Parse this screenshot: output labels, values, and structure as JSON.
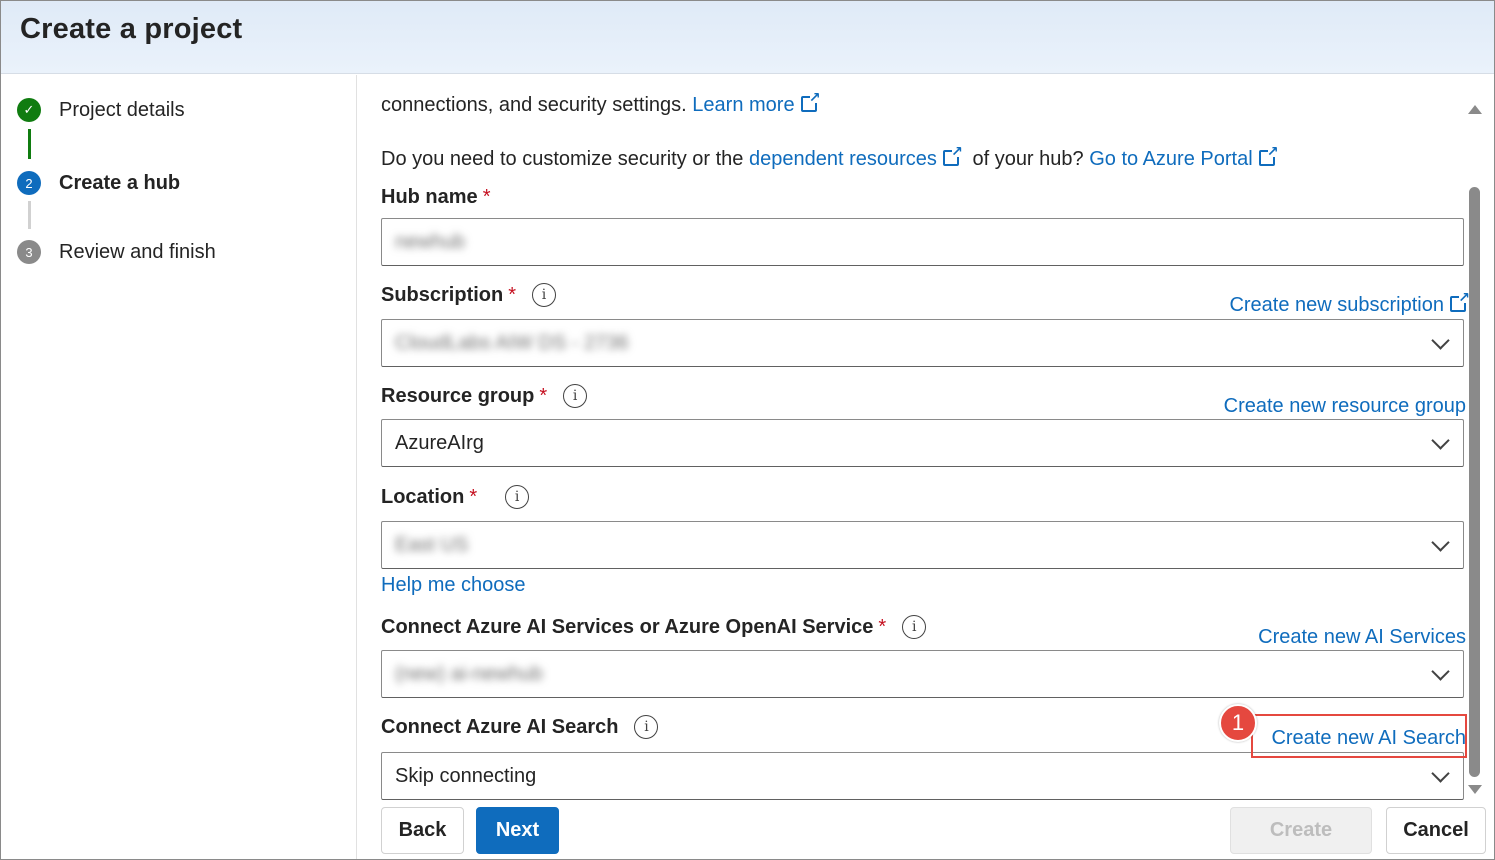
{
  "header": {
    "title": "Create a project"
  },
  "steps": [
    {
      "label": "Project details",
      "state": "done",
      "marker": "✓"
    },
    {
      "label": "Create a hub",
      "state": "current",
      "marker": "2"
    },
    {
      "label": "Review and finish",
      "state": "todo",
      "marker": "3"
    }
  ],
  "intro": {
    "line1_text": "connections, and security settings.",
    "line1_link": "Learn more",
    "line2_text_a": "Do you need to customize security or the",
    "line2_link_a": "dependent resources",
    "line2_text_b": "of your hub?",
    "line2_link_b": "Go to Azure Portal"
  },
  "form": {
    "hub_name": {
      "label": "Hub name",
      "required": "*",
      "value": "newhub"
    },
    "subscription": {
      "label": "Subscription",
      "required": "*",
      "info": "i",
      "link": "Create new subscription",
      "value": "CloudLabs AIW DS - 2736"
    },
    "resource_group": {
      "label": "Resource group",
      "required": "*",
      "info": "i",
      "link": "Create new resource group",
      "value": "AzureAIrg"
    },
    "location": {
      "label": "Location",
      "required": "*",
      "info": "i",
      "value": "East US",
      "help_link": "Help me choose"
    },
    "ai_services": {
      "label": "Connect Azure AI Services or Azure OpenAI Service",
      "required": "*",
      "info": "i",
      "link": "Create new AI Services",
      "value": "(new) ai-newhub"
    },
    "ai_search": {
      "label": "Connect Azure AI Search",
      "info": "i",
      "link": "Create new AI Search",
      "value": "Skip connecting"
    }
  },
  "footer": {
    "back": "Back",
    "next": "Next",
    "create": "Create",
    "cancel": "Cancel"
  },
  "annotation": {
    "badge": "1"
  },
  "colors": {
    "accent": "#0f6cbd",
    "success": "#107c10",
    "required": "#c50f1f",
    "highlight": "#e5483f"
  }
}
